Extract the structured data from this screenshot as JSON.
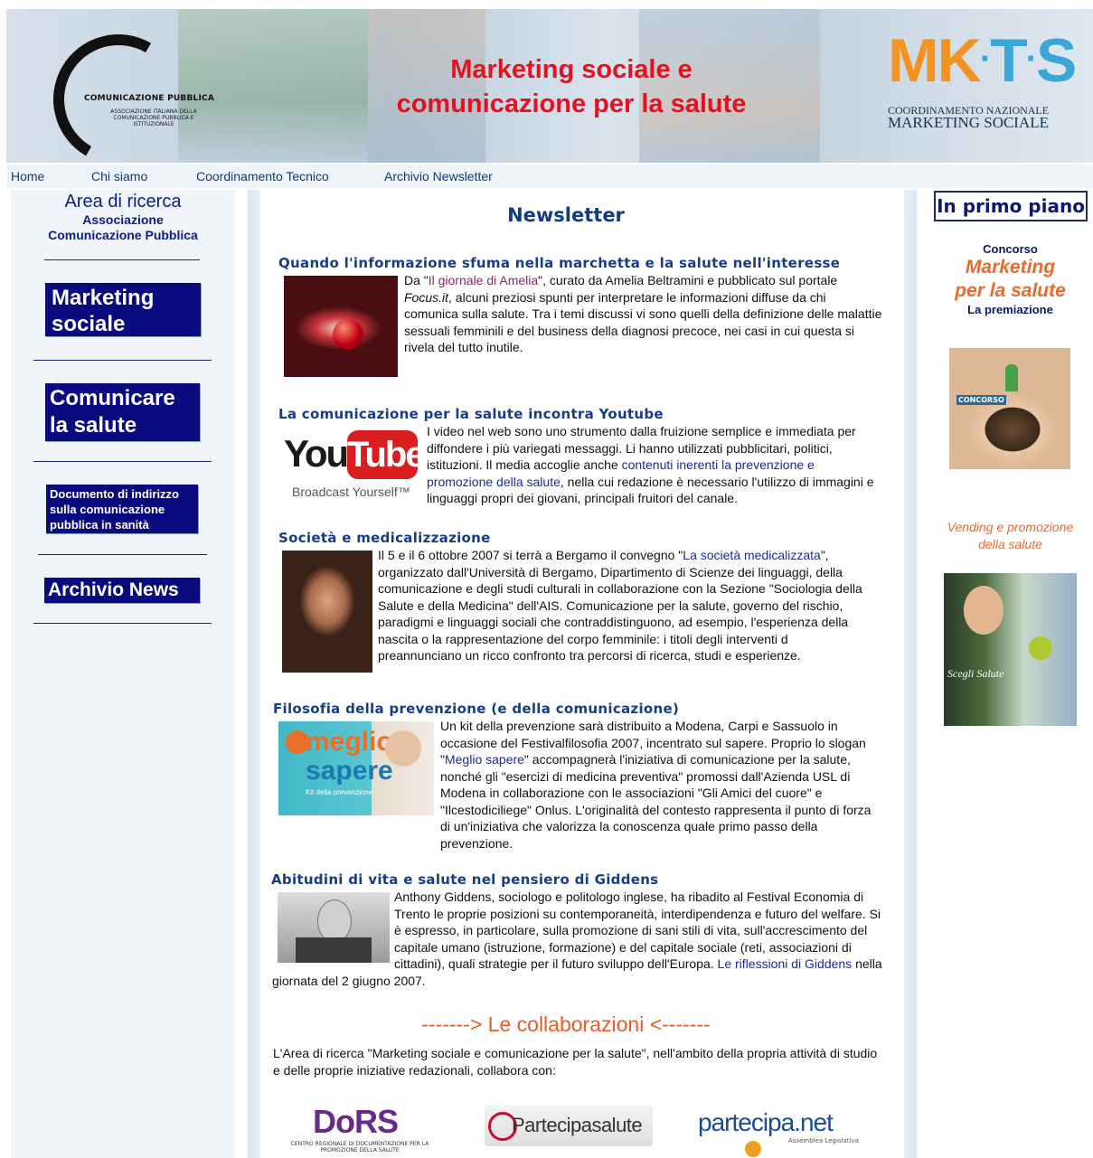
{
  "header": {
    "title_line1": "Marketing sociale e",
    "title_line2": "comunicazione per la salute",
    "left_logo_name": "COMUNICAZIONE PUBBLICA",
    "left_logo_sub": "ASSOCIAZIONE ITALIANA DELLA COMUNICAZIONE PUBBLICA E ISTITUZIONALE",
    "right_logo_text": "MKTS",
    "right_logo_sub1": "COORDINAMENTO NAZIONALE",
    "right_logo_sub2": "MARKETING SOCIALE"
  },
  "nav": {
    "items": [
      {
        "label": "Home"
      },
      {
        "label": "Chi siamo"
      },
      {
        "label": "Coordinamento Tecnico"
      },
      {
        "label": "Archivio Newsletter"
      }
    ]
  },
  "sidebar": {
    "area_line1": "Area di ricerca",
    "area_line2": "Associazione",
    "area_line3": "Comunicazione Pubblica",
    "buttons": [
      {
        "line1": "Marketing",
        "line2": "sociale"
      },
      {
        "line1": "Comunicare",
        "line2": "la salute"
      },
      {
        "line1": "Documento di indirizzo",
        "line2": "sulla comunicazione",
        "line3": "pubblica in sanità"
      },
      {
        "line1": "Archivio News"
      }
    ]
  },
  "main": {
    "title": "Newsletter",
    "articles": [
      {
        "heading": "Quando l'informazione sfuma nella marchetta e la salute nell'interesse",
        "t1": "Da \"",
        "link1": "Il giornale di Amelia",
        "t2": "\", curato da Amelia Beltramini e pubblicato sul portale ",
        "em": "Focus.it",
        "t3": ", alcuni preziosi spunti per interpretare le informazioni diffuse da chi comunica sulla salute. Tra i temi discussi vi sono quelli della definizione delle malattie sessuali femminili e del business della diagnosi precoce, nei casi in cui questa si rivela del tutto inutile."
      },
      {
        "heading": "La comunicazione per la salute incontra Youtube",
        "t1": "I video nel web sono uno strumento dalla fruizione semplice e immediata per diffondere i più variegati messaggi. Li hanno utilizzati pubblicitari, politici, istituzioni. Il media accoglie anche ",
        "link1": "contenuti inerenti la prevenzione e promozione della salute",
        "t2": ", nella cui redazione è necessario l'utilizzo di immagini e linguaggi propri dei giovani, principali fruitori del canale.",
        "logo_you": "You",
        "logo_tube": "Tube",
        "logo_tagline": "Broadcast Yourself™"
      },
      {
        "heading": "Società e medicalizzazione",
        "t1": "Il 5 e il 6 ottobre 2007 si terrà a Bergamo il convegno \"",
        "link1": "La società medicalizzata",
        "t2": "\", organizzato dall'Università di Bergamo, Dipartimento di Scienze dei linguaggi, della comunicazione e degli studi culturali in collaborazione con la Sezione \"Sociologia della Salute e della Medicina\" dell'AIS. Comunicazione per la salute, governo del rischio, paradigmi e linguaggi sociali che contraddistinguono, ad esempio, l'esperienza della nascita o la rappresentazione del corpo femminile: i titoli degli interventi d preannunciano un ricco confronto tra percorsi di ricerca, studi e esperienze."
      },
      {
        "heading": "Filosofia della prevenzione (e della comunicazione)",
        "t1": "Un kit della prevenzione sarà distribuito a Modena, Carpi e Sassuolo in occasione del Festivalfilosofia 2007, incentrato sul sapere. Proprio lo slogan \"",
        "link1": "Meglio sapere",
        "t2": "\" accompagnerà l'iniziativa di comunicazione per la salute, nonché gli \"esercizi di medicina preventiva\" promossi dall'Azienda USL di Modena in collaborazione con le associazioni \"Gli Amici del cuore\" e \"Ilcestodiciliege\" Onlus. L'originalità del contesto rappresenta il punto di forza di un'iniziativa che valorizza la conoscenza quale primo passo della prevenzione.",
        "img_text1": "meglio",
        "img_text2": "sapere",
        "img_text3": "Kit della prevenzione"
      },
      {
        "heading": "Abitudini di vita e salute nel pensiero di Giddens",
        "t1": "Anthony Giddens, sociologo e politologo inglese, ha ribadito al Festival Economia di Trento le proprie posizioni su contemporaneità, interdipendenza e futuro del welfare. Si è espresso, in particolare, sulla promozione di sani stili di vita, sull'accrescimento del capitale umano (istruzione, formazione) e del capitale sociale (reti, associazioni di cittadini), quali strategie per il futuro sviluppo dell'Europa. ",
        "link1": "Le riflessioni di Giddens",
        "t2": " nella giornata del 2 giugno 2007."
      }
    ],
    "collab_title": "-------> Le collaborazioni <-------",
    "collab_text": "L'Area di ricerca \"Marketing sociale e comunicazione per la salute\", nell'ambito della propria attività di studio e delle proprie iniziative redazionali, collabora con:",
    "partners": [
      {
        "name": "DoRS",
        "sub": "CENTRO REGIONALE DI DOCUMENTAZIONE PER LA PROMOZIONE DELLA SALUTE"
      },
      {
        "name": "Partecipasalute"
      },
      {
        "name": "partecipa.net",
        "sub": "Assemblea Legislativa"
      }
    ]
  },
  "right": {
    "primo_piano": "In primo piano",
    "concorso_l1": "Concorso",
    "concorso_l2": "Marketing",
    "concorso_l3": "per la salute",
    "concorso_l4": "La premiazione",
    "concorso_img_text": "CONCORSO",
    "vending_l1": "Vending e promozione",
    "vending_l2": "della salute",
    "vending_img_text": "Scegli Salute"
  },
  "colors": {
    "title_red": "#e8101e",
    "nav_blue": "#123a7a",
    "button_navy": "#0b0b80",
    "heading_blue": "#173c8a",
    "accent_orange": "#ec5a28"
  }
}
